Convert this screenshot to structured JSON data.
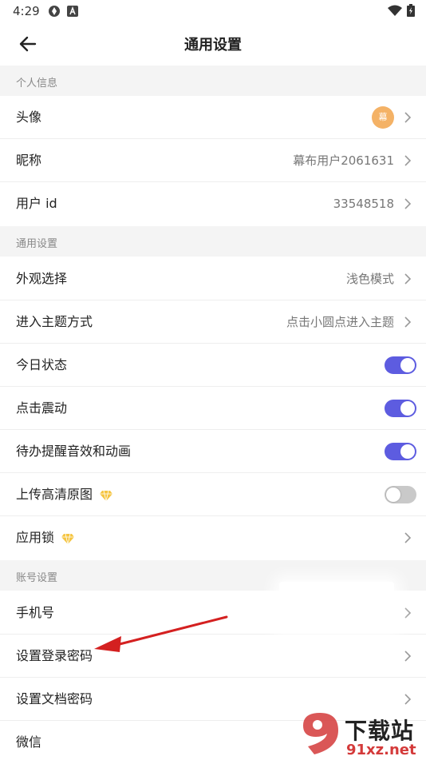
{
  "status_bar": {
    "time": "4:29",
    "icons": [
      "sync-icon",
      "a-icon",
      "wifi-icon",
      "battery-icon"
    ]
  },
  "header": {
    "title": "通用设置",
    "back_icon": "back-arrow-icon"
  },
  "sections": {
    "personal": {
      "title": "个人信息",
      "avatar_label": "头像",
      "avatar_text": "幕",
      "nickname_label": "昵称",
      "nickname_value": "幕布用户2061631",
      "userid_label": "用户 id",
      "userid_value": "33548518"
    },
    "general": {
      "title": "通用设置",
      "appearance_label": "外观选择",
      "appearance_value": "浅色模式",
      "topic_label": "进入主题方式",
      "topic_value": "点击小圆点进入主题",
      "today_label": "今日状态",
      "today_on": true,
      "vibrate_label": "点击震动",
      "vibrate_on": true,
      "todo_label": "待办提醒音效和动画",
      "todo_on": true,
      "upload_label": "上传高清原图",
      "upload_on": false,
      "applock_label": "应用锁"
    },
    "account": {
      "title": "账号设置",
      "phone_label": "手机号",
      "login_pwd_label": "设置登录密码",
      "doc_pwd_label": "设置文档密码",
      "wechat_label": "微信"
    }
  },
  "colors": {
    "toggle_on": "#5d5ce0",
    "toggle_off": "#c9c9c9",
    "section_bg": "#f4f4f4",
    "avatar_bg": "#f4b266",
    "annotation_arrow": "#d42020"
  },
  "watermark": {
    "text": "下载站",
    "url": "91xz.net"
  }
}
